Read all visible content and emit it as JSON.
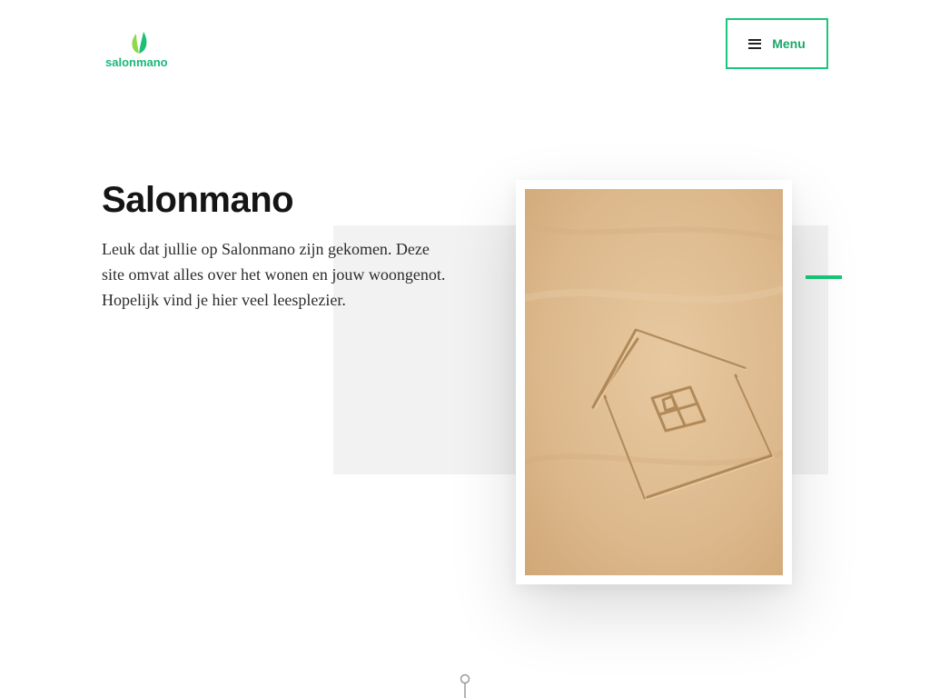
{
  "header": {
    "logo_text": "salonmano",
    "menu_label": "Menu"
  },
  "hero": {
    "title": "Salonmano",
    "intro": "Leuk dat jullie op Salonmano zijn gekomen. Deze site omvat alles over het wonen en jouw woongenot. Hopelijk vind je hier veel leesplezier."
  },
  "icons": {
    "logo": "leaf-icon",
    "menu": "hamburger-icon",
    "scroll": "scroll-down-icon"
  },
  "colors": {
    "accent": "#19c77a",
    "logo_green": "#19b87a",
    "menu_text": "#1aa86b",
    "panel_grey": "#f2f2f2",
    "sand": "#ddb98d"
  }
}
